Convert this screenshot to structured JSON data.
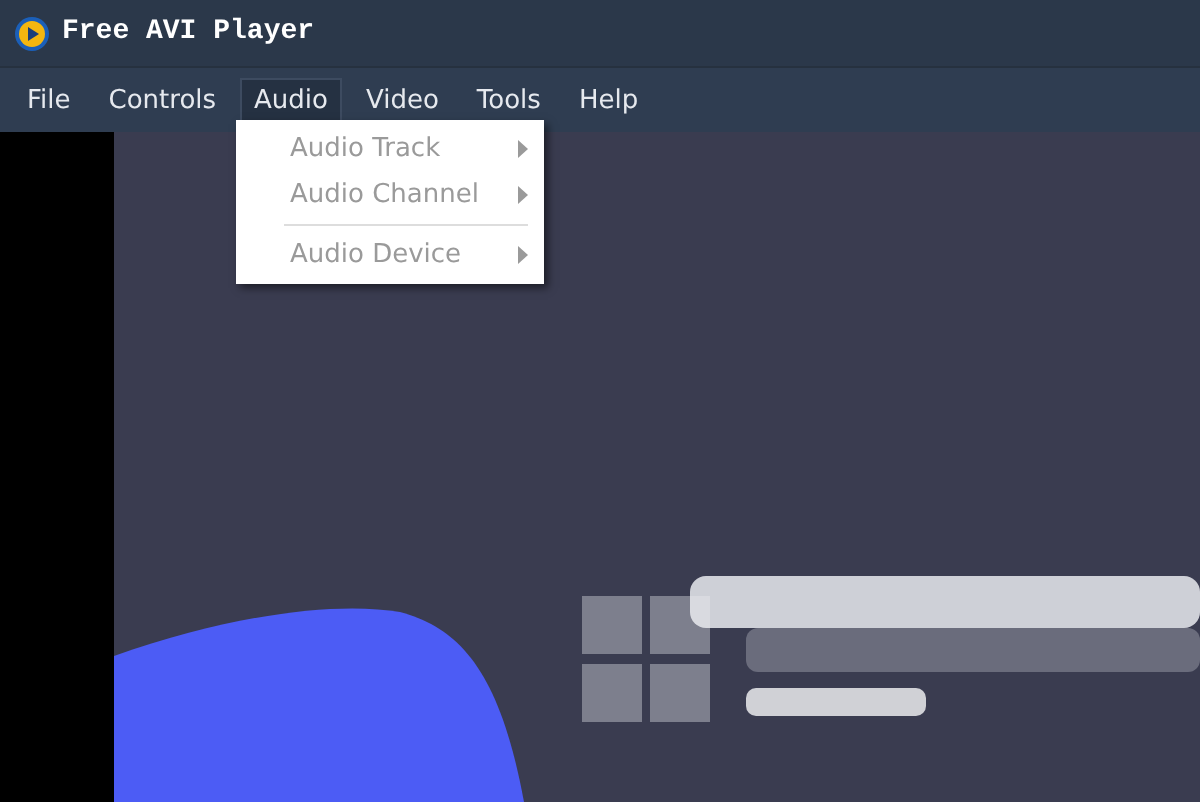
{
  "window": {
    "title": "Free AVI Player"
  },
  "menu_bar": [
    {
      "label": "File",
      "selected": false
    },
    {
      "label": "Controls",
      "selected": false
    },
    {
      "label": "Audio",
      "selected": true
    },
    {
      "label": "Video",
      "selected": false
    },
    {
      "label": "Tools",
      "selected": false
    },
    {
      "label": "Help",
      "selected": false
    }
  ],
  "open_menu": {
    "items": [
      {
        "kind": "item",
        "label": "Audio Track",
        "disabled": true,
        "submenu": true
      },
      {
        "kind": "item",
        "label": "Audio Channel",
        "disabled": true,
        "submenu": true
      },
      {
        "kind": "separator"
      },
      {
        "kind": "item",
        "label": "Audio Device",
        "disabled": true,
        "submenu": true
      }
    ]
  }
}
